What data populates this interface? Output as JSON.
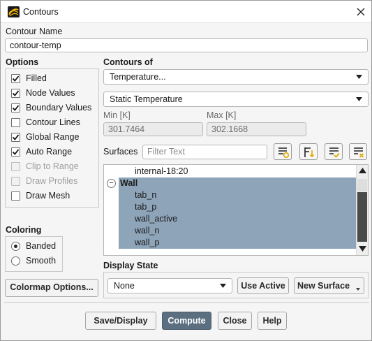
{
  "window": {
    "title": "Contours",
    "icon": "ansys-fluent-icon"
  },
  "contour_name": {
    "label": "Contour Name",
    "value": "contour-temp"
  },
  "options": {
    "label": "Options",
    "items": [
      {
        "label": "Filled",
        "checked": true,
        "enabled": true
      },
      {
        "label": "Node Values",
        "checked": true,
        "enabled": true
      },
      {
        "label": "Boundary Values",
        "checked": true,
        "enabled": true
      },
      {
        "label": "Contour Lines",
        "checked": false,
        "enabled": true
      },
      {
        "label": "Global Range",
        "checked": true,
        "enabled": true
      },
      {
        "label": "Auto Range",
        "checked": true,
        "enabled": true
      },
      {
        "label": "Clip to Range",
        "checked": false,
        "enabled": false
      },
      {
        "label": "Draw Profiles",
        "checked": false,
        "enabled": false
      },
      {
        "label": "Draw Mesh",
        "checked": false,
        "enabled": true
      }
    ]
  },
  "contours_of": {
    "label": "Contours of",
    "field": "Temperature...",
    "variable": "Static Temperature"
  },
  "range": {
    "min_label": "Min [K]",
    "min_value": "301.7464",
    "max_label": "Max [K]",
    "max_value": "302.1668"
  },
  "surfaces": {
    "label": "Surfaces",
    "filter_placeholder": "Filter Text",
    "tool_icons": [
      "new-surface-icon",
      "select-highlighted-icon",
      "select-all-icon",
      "deselect-all-icon"
    ],
    "list": {
      "above": "internal-18:20",
      "group": {
        "toggle": "−",
        "name": "Wall"
      },
      "items": [
        "tab_n",
        "tab_p",
        "wall_active",
        "wall_n",
        "wall_p"
      ]
    }
  },
  "coloring": {
    "label": "Coloring",
    "options": [
      {
        "label": "Banded",
        "selected": true
      },
      {
        "label": "Smooth",
        "selected": false
      }
    ]
  },
  "colormap_button": "Colormap Options...",
  "display_state": {
    "label": "Display State",
    "value": "None",
    "use_active": "Use Active",
    "new_surface": "New Surface"
  },
  "footer": {
    "save_display": "Save/Display",
    "compute": "Compute",
    "close": "Close",
    "help": "Help"
  },
  "colors": {
    "selection": "#8ea4b9",
    "primary_button": "#5c6f80",
    "accent_yellow": "#e0a800"
  }
}
